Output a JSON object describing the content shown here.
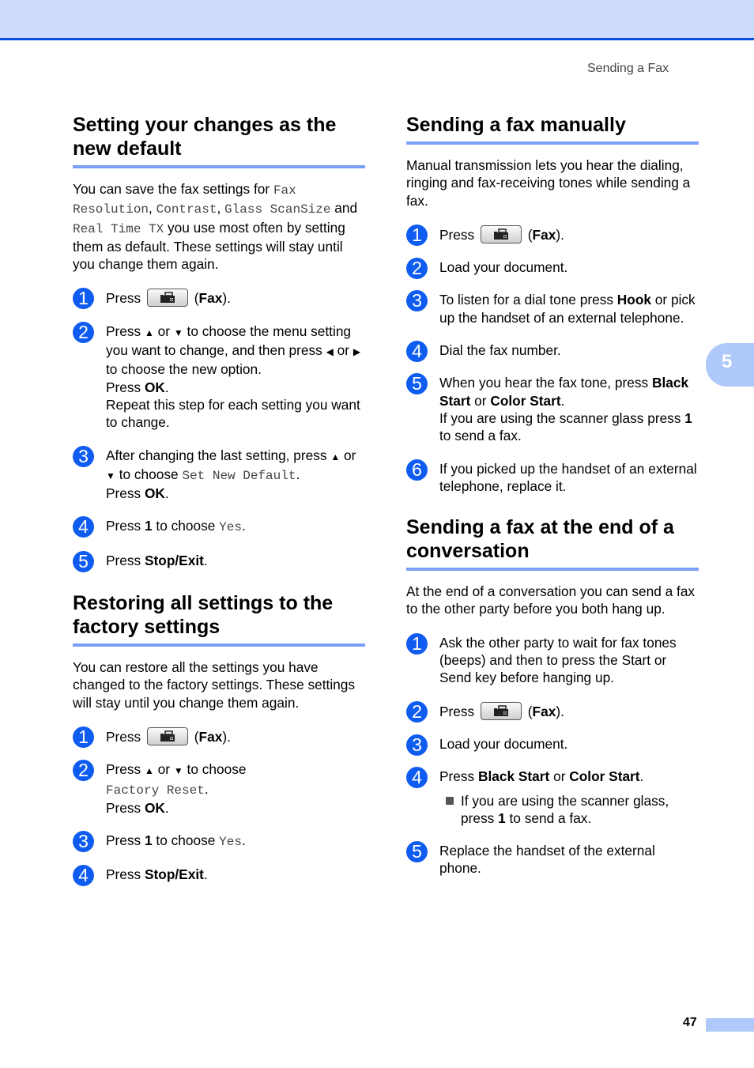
{
  "header": {
    "running_title": "Sending a Fax",
    "accent_color": "#0a4fe0",
    "band_color": "#cddcfd"
  },
  "chapter_tab": {
    "number": "5"
  },
  "footer": {
    "page_number": "47"
  },
  "sections": [
    {
      "id": "left1",
      "title": "Setting your changes as the new default",
      "intro": [
        {
          "t": "You can save the fax settings for "
        },
        {
          "t": "Fax Resolution",
          "s": "mono"
        },
        {
          "t": ", "
        },
        {
          "t": "Contrast",
          "s": "mono"
        },
        {
          "t": ", "
        },
        {
          "t": "Glass ScanSize",
          "s": "mono"
        },
        {
          "t": " and "
        },
        {
          "t": "Real Time TX",
          "s": "mono"
        },
        {
          "t": " you use most often by setting them as default. These settings will stay until you change them again."
        }
      ],
      "steps": [
        {
          "n": "1",
          "parts": [
            {
              "t": "Press "
            },
            {
              "s": "faxbtn"
            },
            {
              "t": " ("
            },
            {
              "t": "Fax",
              "s": "b"
            },
            {
              "t": ")."
            }
          ]
        },
        {
          "n": "2",
          "parts": [
            {
              "t": "Press "
            },
            {
              "t": "▲",
              "s": "tri"
            },
            {
              "t": " or "
            },
            {
              "t": "▼",
              "s": "tri"
            },
            {
              "t": " to choose the menu setting you want to change, and then press "
            },
            {
              "t": "◀",
              "s": "tri"
            },
            {
              "t": " or "
            },
            {
              "t": "▶",
              "s": "tri"
            },
            {
              "t": " to choose the new option."
            },
            {
              "s": "br"
            },
            {
              "t": "Press "
            },
            {
              "t": "OK",
              "s": "b"
            },
            {
              "t": "."
            },
            {
              "s": "br"
            },
            {
              "t": "Repeat this step for each setting you want to change."
            }
          ]
        },
        {
          "n": "3",
          "parts": [
            {
              "t": "After changing the last setting, press "
            },
            {
              "t": "▲",
              "s": "tri"
            },
            {
              "t": " or "
            },
            {
              "t": "▼",
              "s": "tri"
            },
            {
              "t": " to choose "
            },
            {
              "t": "Set New Default",
              "s": "mono"
            },
            {
              "t": "."
            },
            {
              "s": "br"
            },
            {
              "t": "Press "
            },
            {
              "t": "OK",
              "s": "b"
            },
            {
              "t": "."
            }
          ]
        },
        {
          "n": "4",
          "parts": [
            {
              "t": "Press "
            },
            {
              "t": "1",
              "s": "b"
            },
            {
              "t": " to choose "
            },
            {
              "t": "Yes",
              "s": "mono"
            },
            {
              "t": "."
            }
          ]
        },
        {
          "n": "5",
          "parts": [
            {
              "t": "Press "
            },
            {
              "t": "Stop/Exit",
              "s": "b"
            },
            {
              "t": "."
            }
          ]
        }
      ]
    },
    {
      "id": "left2",
      "title": "Restoring all settings to the factory settings",
      "intro": [
        {
          "t": "You can restore all the settings you have changed to the factory settings. These settings will stay until you change them again."
        }
      ],
      "steps": [
        {
          "n": "1",
          "parts": [
            {
              "t": "Press "
            },
            {
              "s": "faxbtn"
            },
            {
              "t": " ("
            },
            {
              "t": "Fax",
              "s": "b"
            },
            {
              "t": ")."
            }
          ]
        },
        {
          "n": "2",
          "parts": [
            {
              "t": "Press "
            },
            {
              "t": "▲",
              "s": "tri"
            },
            {
              "t": " or "
            },
            {
              "t": "▼",
              "s": "tri"
            },
            {
              "t": " to choose "
            },
            {
              "s": "br"
            },
            {
              "t": "Factory Reset",
              "s": "mono"
            },
            {
              "t": "."
            },
            {
              "s": "br"
            },
            {
              "t": "Press "
            },
            {
              "t": "OK",
              "s": "b"
            },
            {
              "t": "."
            }
          ]
        },
        {
          "n": "3",
          "parts": [
            {
              "t": "Press "
            },
            {
              "t": "1",
              "s": "b"
            },
            {
              "t": " to choose "
            },
            {
              "t": "Yes",
              "s": "mono"
            },
            {
              "t": "."
            }
          ]
        },
        {
          "n": "4",
          "parts": [
            {
              "t": "Press "
            },
            {
              "t": "Stop/Exit",
              "s": "b"
            },
            {
              "t": "."
            }
          ]
        }
      ]
    },
    {
      "id": "right1",
      "title": "Sending a fax manually",
      "intro": [
        {
          "t": "Manual transmission lets you hear the dialing, ringing and fax-receiving tones while sending a fax."
        }
      ],
      "steps": [
        {
          "n": "1",
          "parts": [
            {
              "t": "Press "
            },
            {
              "s": "faxbtn"
            },
            {
              "t": " ("
            },
            {
              "t": "Fax",
              "s": "b"
            },
            {
              "t": ")."
            }
          ]
        },
        {
          "n": "2",
          "parts": [
            {
              "t": "Load your document."
            }
          ]
        },
        {
          "n": "3",
          "parts": [
            {
              "t": "To listen for a dial tone press "
            },
            {
              "t": "Hook",
              "s": "b"
            },
            {
              "t": " or pick up the handset of an external telephone."
            }
          ]
        },
        {
          "n": "4",
          "parts": [
            {
              "t": "Dial the fax number."
            }
          ]
        },
        {
          "n": "5",
          "parts": [
            {
              "t": "When you hear the fax tone, press "
            },
            {
              "t": "Black Start",
              "s": "b"
            },
            {
              "t": " or "
            },
            {
              "t": "Color Start",
              "s": "b"
            },
            {
              "t": "."
            },
            {
              "s": "br"
            },
            {
              "t": "If you are using the scanner glass press "
            },
            {
              "t": "1",
              "s": "b"
            },
            {
              "t": " to send a fax."
            }
          ]
        },
        {
          "n": "6",
          "parts": [
            {
              "t": "If you picked up the handset of an external telephone, replace it."
            }
          ]
        }
      ]
    },
    {
      "id": "right2",
      "title": "Sending a fax at the end of a conversation",
      "intro": [
        {
          "t": "At the end of a conversation you can send a fax to the other party before you both hang up."
        }
      ],
      "steps": [
        {
          "n": "1",
          "parts": [
            {
              "t": "Ask the other party to wait for fax tones (beeps) and then to press the Start or Send key before hanging up."
            }
          ]
        },
        {
          "n": "2",
          "parts": [
            {
              "t": "Press "
            },
            {
              "s": "faxbtn"
            },
            {
              "t": " ("
            },
            {
              "t": "Fax",
              "s": "b"
            },
            {
              "t": ")."
            }
          ]
        },
        {
          "n": "3",
          "parts": [
            {
              "t": "Load your document."
            }
          ]
        },
        {
          "n": "4",
          "parts": [
            {
              "t": "Press "
            },
            {
              "t": "Black Start",
              "s": "b"
            },
            {
              "t": " or "
            },
            {
              "t": "Color Start",
              "s": "b"
            },
            {
              "t": "."
            }
          ],
          "bullets": [
            [
              {
                "t": "If you are using the scanner glass, press "
              },
              {
                "t": "1",
                "s": "b"
              },
              {
                "t": " to send a fax."
              }
            ]
          ]
        },
        {
          "n": "5",
          "parts": [
            {
              "t": "Replace the handset of the external phone."
            }
          ]
        }
      ]
    }
  ]
}
